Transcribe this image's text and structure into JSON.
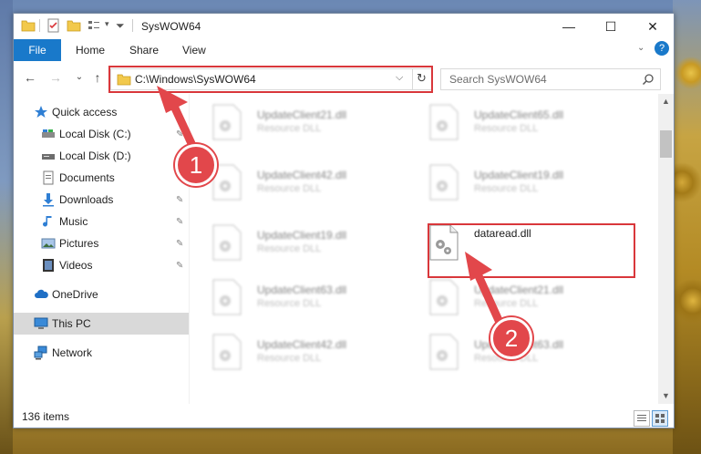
{
  "window": {
    "title": "SysWOW64",
    "controls": {
      "minimize": "—",
      "maximize": "☐",
      "close": "✕"
    }
  },
  "ribbon": {
    "tabs": [
      {
        "label": "File"
      },
      {
        "label": "Home"
      },
      {
        "label": "Share"
      },
      {
        "label": "View"
      }
    ],
    "help": "?"
  },
  "nav": {
    "back": "←",
    "forward": "→",
    "recent": "⌄",
    "up": "↑",
    "address": "C:\\Windows\\SysWOW64",
    "refresh": "↻",
    "search_placeholder": "Search SysWOW64"
  },
  "sidebar": {
    "items": [
      {
        "label": "Quick access",
        "icon": "star-icon"
      },
      {
        "label": "Local Disk (C:)",
        "icon": "drive-icon"
      },
      {
        "label": "Local Disk (D:)",
        "icon": "drive-icon"
      },
      {
        "label": "Documents",
        "icon": "documents-icon"
      },
      {
        "label": "Downloads",
        "icon": "download-icon"
      },
      {
        "label": "Music",
        "icon": "music-icon"
      },
      {
        "label": "Pictures",
        "icon": "pictures-icon"
      },
      {
        "label": "Videos",
        "icon": "videos-icon"
      },
      {
        "label": "OneDrive",
        "icon": "cloud-icon"
      },
      {
        "label": "This PC",
        "icon": "computer-icon"
      },
      {
        "label": "Network",
        "icon": "network-icon"
      }
    ]
  },
  "files": [
    {
      "name": "UpdateClient21.dll",
      "desc": "Resource DLL"
    },
    {
      "name": "UpdateClient65.dll",
      "desc": "Resource DLL"
    },
    {
      "name": "UpdateClient42.dll",
      "desc": "Resource DLL"
    },
    {
      "name": "UpdateClient19.dll",
      "desc": "Resource DLL"
    },
    {
      "name": "UpdateClient19.dll",
      "desc": "Resource DLL"
    },
    {
      "name": "dataread.dll",
      "desc": ""
    },
    {
      "name": "UpdateClient63.dll",
      "desc": "Resource DLL"
    },
    {
      "name": "UpdateClient21.dll",
      "desc": "Resource DLL"
    },
    {
      "name": "UpdateClient42.dll",
      "desc": "Resource DLL"
    },
    {
      "name": "UpdateClient63.dll",
      "desc": "Resource DLL"
    }
  ],
  "status": {
    "count": "136 items"
  },
  "annotations": {
    "step1": "1",
    "step2": "2",
    "color": "#e2474b"
  }
}
